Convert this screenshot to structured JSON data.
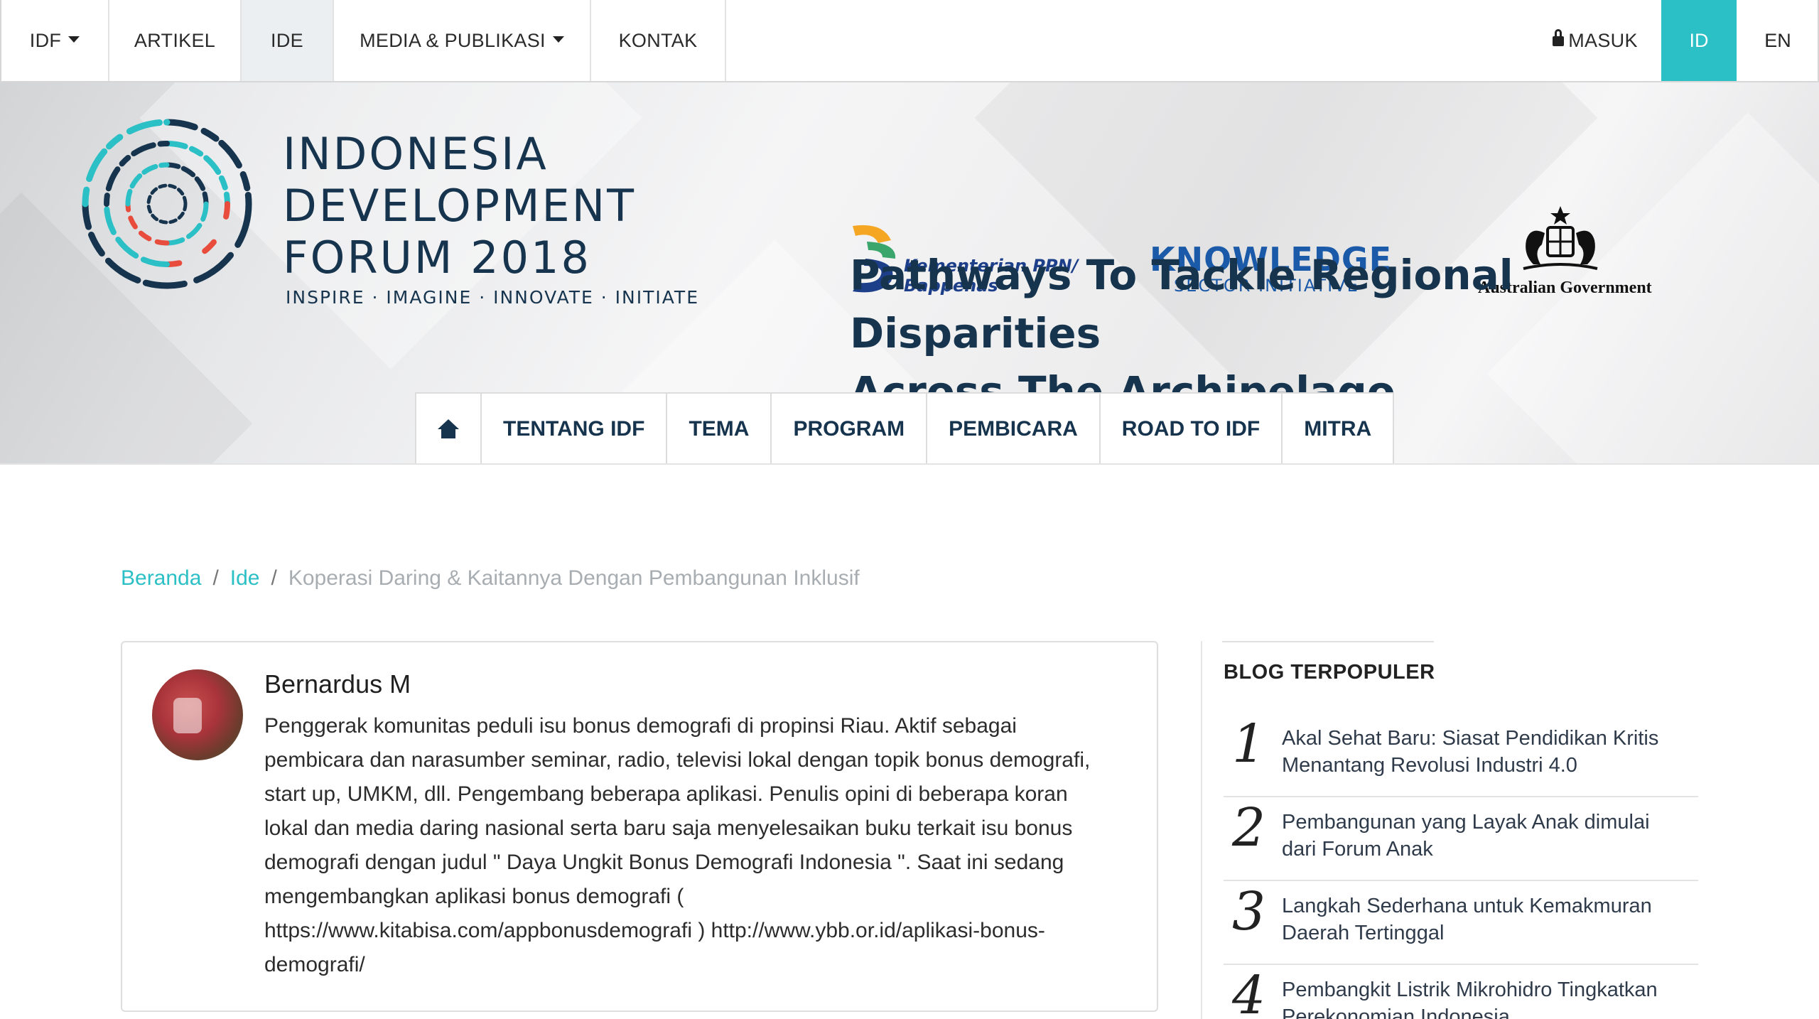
{
  "topnav": {
    "idf": "IDF",
    "artikel": "ARTIKEL",
    "ide": "IDE",
    "media": "MEDIA & PUBLIKASI",
    "kontak": "KONTAK",
    "masuk": "MASUK",
    "lang_id": "ID",
    "lang_en": "EN"
  },
  "hero": {
    "logo_line1": "INDONESIA",
    "logo_line2": "DEVELOPMENT",
    "logo_line3": "FORUM 2018",
    "tagline": "INSPIRE · IMAGINE · INNOVATE · INITIATE",
    "bappenas_line1": "Kementerian PPN/",
    "bappenas_line2": "Bappenas",
    "ksi_title": "KNOWLEDGE",
    "ksi_sub": "SECTOR INITIATIVE",
    "ausgov": "Australian Government",
    "headline_line1": "Pathways To Tackle Regional Disparities",
    "headline_line2": "Across The Archipelago"
  },
  "subnav": {
    "home_icon": "home-icon",
    "items": [
      "TENTANG IDF",
      "TEMA",
      "PROGRAM",
      "PEMBICARA",
      "ROAD TO IDF",
      "MITRA"
    ]
  },
  "breadcrumb": {
    "home": "Beranda",
    "section": "Ide",
    "current": "Koperasi Daring & Kaitannya Dengan Pembangunan Inklusif"
  },
  "author": {
    "name": "Bernardus M",
    "bio": "Penggerak komunitas peduli isu bonus demografi di propinsi Riau. Aktif sebagai pembicara dan narasumber seminar, radio, televisi lokal dengan topik bonus demografi, start up, UMKM, dll. Pengembang beberapa aplikasi. Penulis opini di beberapa koran lokal dan media daring nasional serta baru saja menyelesaikan buku terkait isu bonus demografi dengan judul \" Daya Ungkit Bonus Demografi Indonesia \". Saat ini sedang mengembangkan aplikasi bonus demografi ( https://www.kitabisa.com/appbonusdemografi ) http://www.ybb.or.id/aplikasi-bonus-demografi/"
  },
  "popular": {
    "title": "BLOG TERPOPULER",
    "items": [
      {
        "num": "1",
        "title": "Akal Sehat Baru: Siasat Pendidikan Kritis Menantang Revolusi Industri 4.0"
      },
      {
        "num": "2",
        "title": "Pembangunan yang Layak Anak dimulai dari Forum Anak"
      },
      {
        "num": "3",
        "title": "Langkah Sederhana untuk Kemakmuran Daerah Tertinggal"
      },
      {
        "num": "4",
        "title": "Pembangkit Listrik Mikrohidro Tingkatkan Perekonomian Indonesia"
      }
    ]
  },
  "colors": {
    "accent": "#2bbfc6",
    "navy": "#16344d"
  }
}
